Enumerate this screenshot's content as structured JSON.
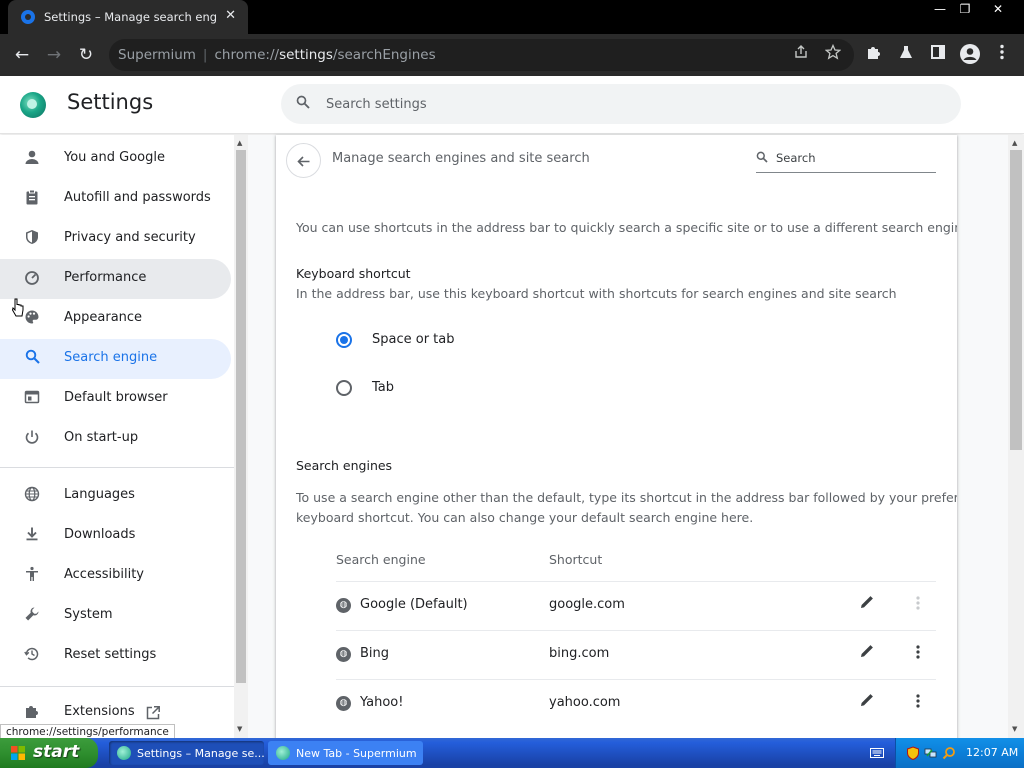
{
  "browser": {
    "tab_title": "Settings – Manage search engines a",
    "tab_close": "✕",
    "window_controls": {
      "minimize": "—",
      "restore": "❐",
      "close": "✕"
    },
    "toolbar": {
      "back": "←",
      "forward": "→",
      "reload": "↻"
    },
    "omnibox": {
      "site_name": "Supermium",
      "separator": "|",
      "url_scheme": "chrome://",
      "url_host": "settings",
      "url_path": "/searchEngines"
    }
  },
  "settings": {
    "title": "Settings",
    "search_placeholder": "Search settings",
    "sidebar": [
      {
        "label": "You and Google"
      },
      {
        "label": "Autofill and passwords"
      },
      {
        "label": "Privacy and security"
      },
      {
        "label": "Performance"
      },
      {
        "label": "Appearance"
      },
      {
        "label": "Search engine"
      },
      {
        "label": "Default browser"
      },
      {
        "label": "On start-up"
      },
      {
        "label": "Languages"
      },
      {
        "label": "Downloads"
      },
      {
        "label": "Accessibility"
      },
      {
        "label": "System"
      },
      {
        "label": "Reset settings"
      },
      {
        "label": "Extensions"
      }
    ],
    "page": {
      "title": "Manage search engines and site search",
      "search_placeholder": "Search",
      "intro": "You can use shortcuts in the address bar to quickly search a specific site or to use a different search engine",
      "keyboard_shortcut_heading": "Keyboard shortcut",
      "keyboard_shortcut_desc": "In the address bar, use this keyboard shortcut with shortcuts for search engines and site search",
      "radio_options": [
        {
          "label": "Space or tab",
          "checked": true
        },
        {
          "label": "Tab",
          "checked": false
        }
      ],
      "search_engines_heading": "Search engines",
      "search_engines_desc_line1": "To use a search engine other than the default, type its shortcut in the address bar followed by your preferred",
      "search_engines_desc_line2": "keyboard shortcut. You can also change your default search engine here.",
      "columns": {
        "engine": "Search engine",
        "shortcut": "Shortcut"
      },
      "engines": [
        {
          "name": "Google (Default)",
          "shortcut": "google.com"
        },
        {
          "name": "Bing",
          "shortcut": "bing.com"
        },
        {
          "name": "Yahoo!",
          "shortcut": "yahoo.com"
        }
      ]
    }
  },
  "status_url": "chrome://settings/performance",
  "taskbar": {
    "start_label": "start",
    "tasks": [
      {
        "label": "Settings – Manage se..."
      },
      {
        "label": "New Tab - Supermium"
      }
    ],
    "clock": "12:07 AM"
  },
  "colors": {
    "accent": "#1a73e8",
    "active_nav_bg": "#e8f0fe",
    "toolbar_bg": "#2b2b2b",
    "taskbar_blue": "#245edb",
    "start_green": "#2f8f2f"
  }
}
